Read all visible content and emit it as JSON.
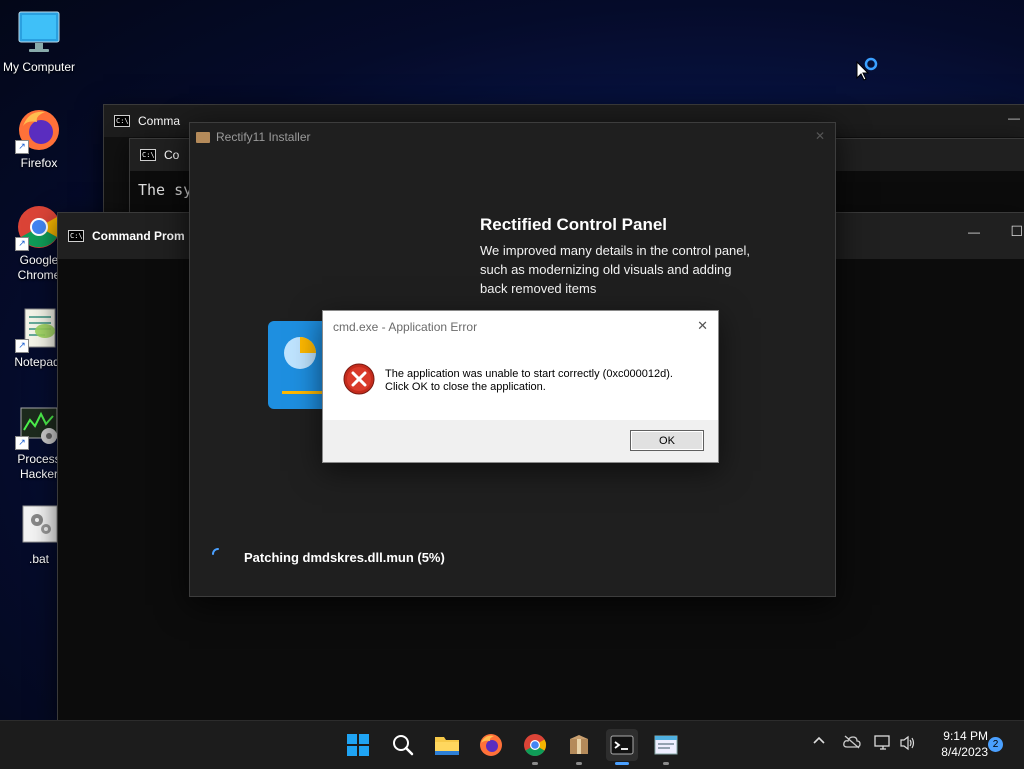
{
  "desktop": {
    "icons": [
      {
        "label": "My Computer"
      },
      {
        "label": "Firefox"
      },
      {
        "label_line1": "Google",
        "label_line2": "Chrome"
      },
      {
        "label": "Notepad-"
      },
      {
        "label_line1": "Process",
        "label_line2": "Hacker"
      },
      {
        "label": ".bat"
      }
    ]
  },
  "windows": {
    "cmd_back": {
      "title": "Comma"
    },
    "cmd_middle": {
      "title": "Co",
      "body_text": "The sy"
    },
    "cmd_front": {
      "title": "Command Prom"
    }
  },
  "installer": {
    "title": "Rectify11 Installer",
    "feature_heading": "Rectified Control Panel",
    "feature_description": "We improved many details in the control panel, such as modernizing old visuals and adding back removed items",
    "status": "Patching dmdskres.dll.mun (5%)",
    "progress_percent": 5
  },
  "dialog": {
    "title": "cmd.exe - Application Error",
    "message_line1": "The application was unable to start correctly (0xc000012d).",
    "message_line2": "Click OK to close the application.",
    "ok_label": "OK",
    "close_glyph": "✕"
  },
  "taskbar": {
    "apps": [
      "start-icon",
      "search-icon",
      "file-explorer-icon",
      "firefox-icon",
      "chrome-icon",
      "installer-icon",
      "terminal-icon",
      "notepad-icon"
    ],
    "time": "9:14 PM",
    "date": "8/4/2023",
    "notification_count": "2"
  },
  "window_controls": {
    "minimize": "—",
    "maximize": "☐"
  },
  "colors": {
    "accent": "#0078d4",
    "error_red": "#c42b1c",
    "taskbar": "#1c1c1c"
  }
}
